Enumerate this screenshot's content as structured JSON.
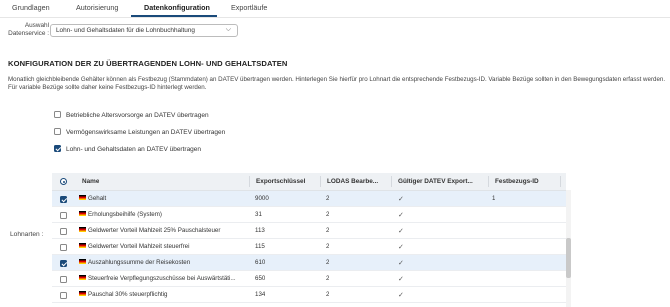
{
  "tabs": [
    {
      "label": "Grundlagen"
    },
    {
      "label": "Autorisierung"
    },
    {
      "label": "Datenkonfiguration"
    },
    {
      "label": "Exportläufe"
    }
  ],
  "datenservice": {
    "label": "Auswahl Datenservice :",
    "value": "Lohn- und Gehaltsdaten für die Lohnbuchhaltung"
  },
  "section": {
    "title": "KONFIGURATION DER ZU ÜBERTRAGENDEN LOHN- UND GEHALTSDATEN",
    "description": "Monatlich gleichbleibende Gehälter können als Festbezug (Stammdaten) an DATEV übertragen werden. Hinterlegen Sie hierfür pro Lohnart die entsprechende Festbezugs-ID. Variable Bezüge sollten in den Bewegungsdaten erfasst werden. Für variable Bezüge sollte daher keine Festbezugs-ID hinterlegt werden."
  },
  "options": [
    {
      "label": "Betriebliche Altersvorsorge an DATEV übertragen",
      "checked": false
    },
    {
      "label": "Vermögenswirksame Leistungen an DATEV übertragen",
      "checked": false
    },
    {
      "label": "Lohn- und Gehaltsdaten an DATEV übertragen",
      "checked": true
    }
  ],
  "lohnarten_label": "Lohnarten :",
  "table": {
    "columns": [
      "Name",
      "Exportschlüssel",
      "LODAS Bearbe...",
      "Gültiger DATEV Export...",
      "Festbezugs-ID"
    ],
    "rows": [
      {
        "selected": true,
        "name": "Gehalt",
        "key": "9000",
        "lodas": "2",
        "valid": "✓",
        "fid": "1"
      },
      {
        "selected": false,
        "name": "Erholungsbeihilfe (System)",
        "key": "31",
        "lodas": "2",
        "valid": "✓",
        "fid": ""
      },
      {
        "selected": false,
        "name": "Geldwerter Vorteil Mahlzeit 25% Pauschalsteuer",
        "key": "113",
        "lodas": "2",
        "valid": "✓",
        "fid": ""
      },
      {
        "selected": false,
        "name": "Geldwerter Vorteil Mahlzeit steuerfrei",
        "key": "115",
        "lodas": "2",
        "valid": "✓",
        "fid": ""
      },
      {
        "selected": true,
        "name": "Auszahlungssumme der Reisekosten",
        "key": "610",
        "lodas": "2",
        "valid": "✓",
        "fid": ""
      },
      {
        "selected": false,
        "name": "Steuerfreie Verpflegungszuschüsse bei Auswärtstäti...",
        "key": "650",
        "lodas": "2",
        "valid": "✓",
        "fid": ""
      },
      {
        "selected": false,
        "name": "Pauschal 30% steuerpflichtig",
        "key": "134",
        "lodas": "2",
        "valid": "✓",
        "fid": ""
      }
    ]
  },
  "colors": {
    "accent": "#1a4a7a",
    "selected_row": "#e7f0fa"
  }
}
